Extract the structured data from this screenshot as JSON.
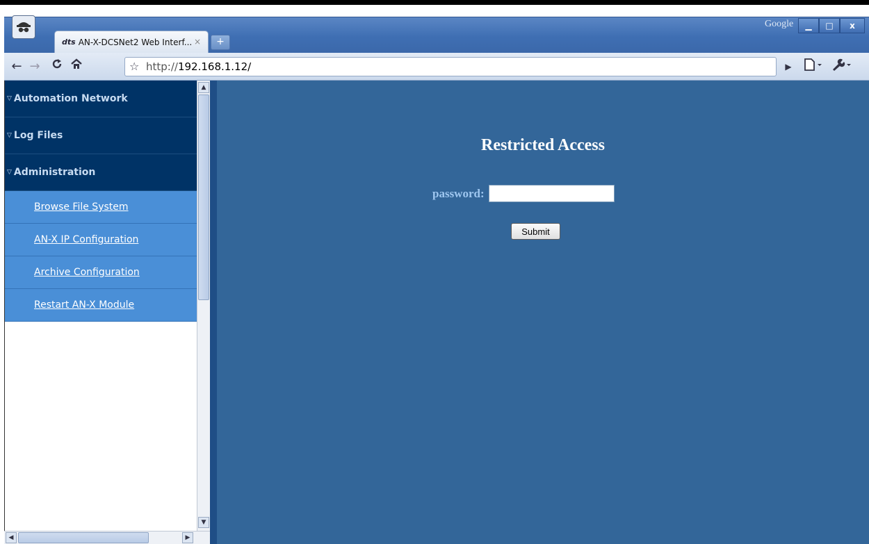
{
  "browser": {
    "tab_title": "AN-X-DCSNet2 Web Interf...",
    "tab_favicon": "dts",
    "tab_close": "×",
    "new_tab": "+",
    "brand": "Google",
    "url_scheme": "http://",
    "url_host": "192.168.1.12/",
    "window_minimize": "▁",
    "window_maximize": "□",
    "window_close": "x"
  },
  "sidebar": {
    "sections": [
      {
        "label": "Automation Network"
      },
      {
        "label": "Log Files"
      },
      {
        "label": "Administration"
      }
    ],
    "sub_items": [
      {
        "label": "Browse File System"
      },
      {
        "label": "AN-X IP Configuration"
      },
      {
        "label": "Archive Configuration"
      },
      {
        "label": "Restart AN-X Module"
      }
    ]
  },
  "main": {
    "title": "Restricted Access",
    "password_label": "password:",
    "password_value": "",
    "submit_label": "Submit"
  },
  "colors": {
    "main_bg": "#336699",
    "section_bg": "#003366",
    "subitem_bg": "#4a8fd7",
    "label_color": "#9fc7f0"
  }
}
